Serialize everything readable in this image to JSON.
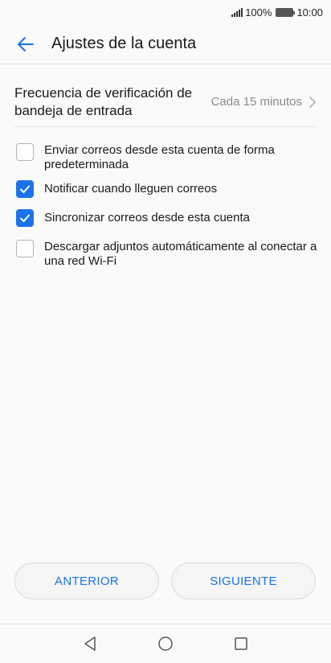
{
  "status_bar": {
    "battery": "100%",
    "time": "10:00"
  },
  "header": {
    "title": "Ajustes de la cuenta"
  },
  "frequency": {
    "label": "Frecuencia de verificación de bandeja de entrada",
    "value": "Cada 15 minutos"
  },
  "options": [
    {
      "label": "Enviar correos desde esta cuenta de forma predeterminada",
      "checked": false
    },
    {
      "label": "Notificar cuando lleguen correos",
      "checked": true
    },
    {
      "label": "Sincronizar correos desde esta cuenta",
      "checked": true
    },
    {
      "label": "Descargar adjuntos automáticamente al conectar a una red Wi-Fi",
      "checked": false
    }
  ],
  "buttons": {
    "previous": "ANTERIOR",
    "next": "SIGUIENTE"
  },
  "colors": {
    "accent": "#1a73e8",
    "background": "#fafafa"
  },
  "icons": [
    "signal-icon",
    "battery-icon",
    "back-arrow-icon",
    "chevron-right-icon",
    "checkmark-icon",
    "nav-back-icon",
    "nav-home-icon",
    "nav-recents-icon"
  ]
}
